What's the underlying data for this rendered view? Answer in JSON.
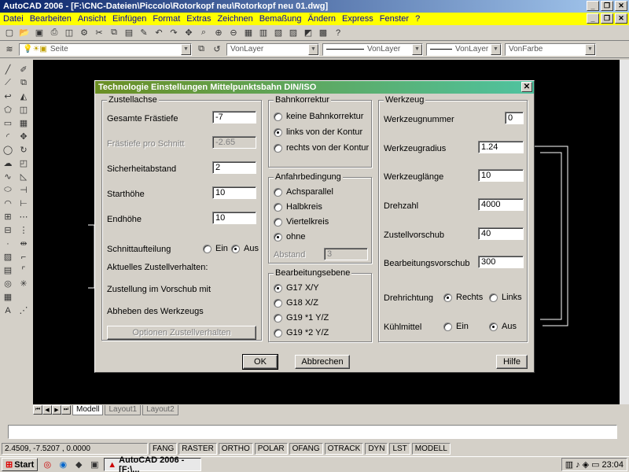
{
  "window": {
    "title": "AutoCAD 2006 - [F:\\CNC-Dateien\\Piccolo\\Rotorkopf neu\\Rotorkopf neu 01.dwg]"
  },
  "menu": [
    "Datei",
    "Bearbeiten",
    "Ansicht",
    "Einfügen",
    "Format",
    "Extras",
    "Zeichnen",
    "Bemaßung",
    "Ändern",
    "Express",
    "Fenster",
    "?"
  ],
  "toolbar": {
    "layer_combo": "Seite",
    "color_combo": "VonLayer",
    "linetype_combo": "VonLayer",
    "lineweight_combo": "VonLayer",
    "plotstyle_combo": "VonFarbe"
  },
  "dialog": {
    "title": "Technologie Einstellungen Mittelpunktsbahn DIN/ISO",
    "zustellachse": {
      "title": "Zustellachse",
      "gesamte_frastiefe_label": "Gesamte Frästiefe",
      "gesamte_frastiefe": "-7",
      "frastiefe_schnitt_label": "Frästiefe pro Schnitt",
      "frastiefe_schnitt": "-2.65",
      "sicherheitabstand_label": "Sicherheitabstand",
      "sicherheitabstand": "2",
      "starthohe_label": "Starthöhe",
      "starthohe": "10",
      "endhohe_label": "Endhöhe",
      "endhohe": "10",
      "schnittaufteilung_label": "Schnittaufteilung",
      "ein": "Ein",
      "aus": "Aus",
      "aktuelles_label": "Aktuelles Zustellverhalten:",
      "zustellung_label": "Zustellung im Vorschub mit",
      "abheben_label": "Abheben des Werkzeugs",
      "optionen_button": "Optionen Zustellverhalten"
    },
    "bahnkorrektur": {
      "title": "Bahnkorrektur",
      "options": [
        "keine Bahnkorrektur",
        "links von der Kontur",
        "rechts von der Kontur"
      ],
      "selected": 1
    },
    "anfahrbedingung": {
      "title": "Anfahrbedingung",
      "options": [
        "Achsparallel",
        "Halbkreis",
        "Viertelkreis",
        "ohne"
      ],
      "selected": 3,
      "abstand_label": "Abstand",
      "abstand": "3"
    },
    "bearbeitungsebene": {
      "title": "Bearbeitungsebene",
      "options": [
        "G17 X/Y",
        "G18 X/Z",
        "G19 *1 Y/Z",
        "G19 *2 Y/Z"
      ],
      "selected": 0
    },
    "werkzeug": {
      "title": "Werkzeug",
      "werkzeugnummer_label": "Werkzeugnummer",
      "werkzeugnummer": "0",
      "werkzeugradius_label": "Werkzeugradius",
      "werkzeugradius": "1.24",
      "werkzeuglange_label": "Werkzeuglänge",
      "werkzeuglange": "10",
      "drehzahl_label": "Drehzahl",
      "drehzahl": "4000",
      "zustellvorschub_label": "Zustellvorschub",
      "zustellvorschub": "40",
      "bearbeitungsvorschub_label": "Bearbeitungsvorschub",
      "bearbeitungsvorschub": "300",
      "drehrichtung_label": "Drehrichtung",
      "rechts": "Rechts",
      "links": "Links",
      "kuhlmittel_label": "Kühlmittel",
      "ein": "Ein",
      "aus": "Aus"
    },
    "ok_button": "OK",
    "abbrechen_button": "Abbrechen",
    "hilfe_button": "Hilfe"
  },
  "tabs": [
    "Modell",
    "Layout1",
    "Layout2"
  ],
  "status": {
    "coords": "2.4509, -7.5207 , 0.0000",
    "buttons": [
      "FANG",
      "RASTER",
      "ORTHO",
      "POLAR",
      "OFANG",
      "OTRACK",
      "DYN",
      "LST",
      "MODELL"
    ]
  },
  "taskbar": {
    "start": "Start",
    "task": "AutoCAD 2006 - [F:\\...",
    "clock": "23:04"
  },
  "colors": {
    "title_gradient_start": "#0a246a",
    "menu_bg": "#ffff00",
    "dialog_title_start": "#6b8e23"
  }
}
